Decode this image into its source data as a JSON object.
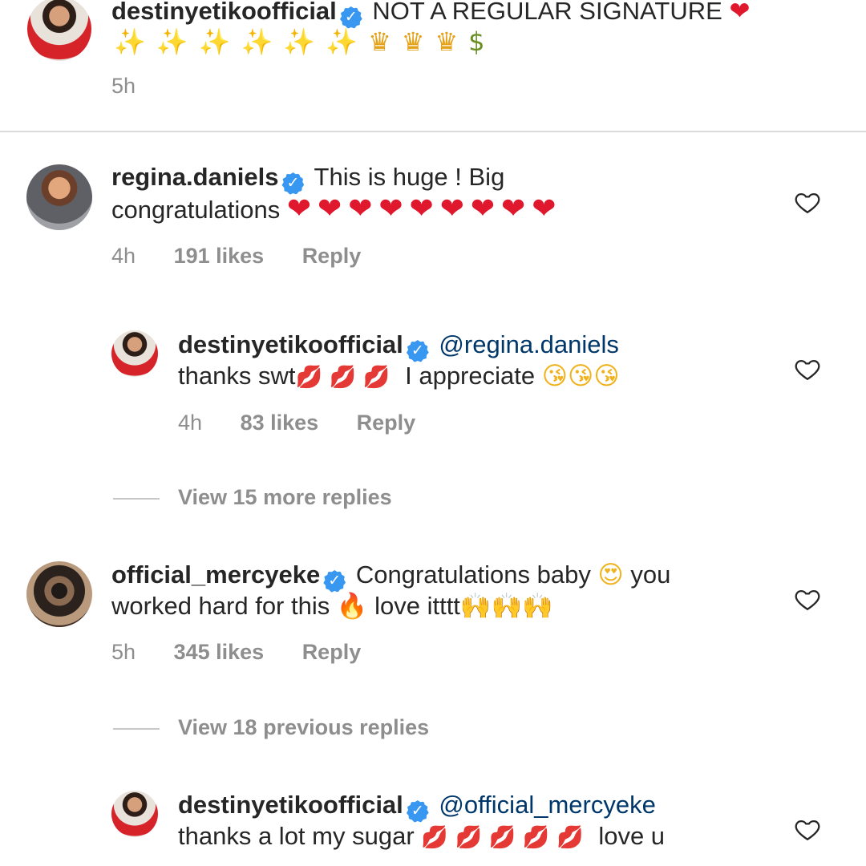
{
  "caption": {
    "username": "destinyetikoofficial",
    "text": "NOT A REGULAR SIGNATURE",
    "emoji_line_1": "❤",
    "stars": "✨✨✨✨✨✨",
    "crowns": "♛♛♛",
    "money": "$",
    "time": "5h"
  },
  "comments": [
    {
      "username": "regina.daniels",
      "text_line_1": "This is huge ! Big",
      "text_line_2": "congratulations",
      "hearts": "❤❤❤❤❤❤❤❤❤",
      "time": "4h",
      "likes": "191 likes",
      "reply_label": "Reply",
      "avatar_icon": "profile-photo-icon",
      "reply": {
        "username": "destinyetikoofficial",
        "mention": "@regina.daniels",
        "text_part_1": "thanks swt",
        "kisses": "💋 💋 💋",
        "text_part_2": "I appreciate",
        "faces": "😘😘😘",
        "time": "4h",
        "likes": "83 likes",
        "reply_label": "Reply"
      },
      "view_more": "View 15 more replies"
    },
    {
      "username": "official_mercyeke",
      "text_line_1": "Congratulations baby",
      "face": "😍",
      "text_line_1b": "you",
      "text_line_2": "worked hard for this",
      "fire": "🔥",
      "text_line_2b": "love itttt",
      "hands": "🙌🙌🙌",
      "time": "5h",
      "likes": "345 likes",
      "reply_label": "Reply",
      "view_previous": "View 18 previous replies",
      "reply": {
        "username": "destinyetikoofficial",
        "mention": "@official_mercyeke",
        "text_part_1": "thanks a lot my sugar",
        "kisses": "💋 💋 💋 💋 💋",
        "text_part_2": "love u"
      }
    }
  ],
  "colors": {
    "verified_badge": "#3897f0",
    "mention": "#00376b",
    "meta_gray": "#8e8e8e",
    "heart_red": "#e0182d"
  },
  "icons": {
    "verified": "verified-badge-icon",
    "like": "heart-outline-icon"
  },
  "badge_glyph": "✓"
}
